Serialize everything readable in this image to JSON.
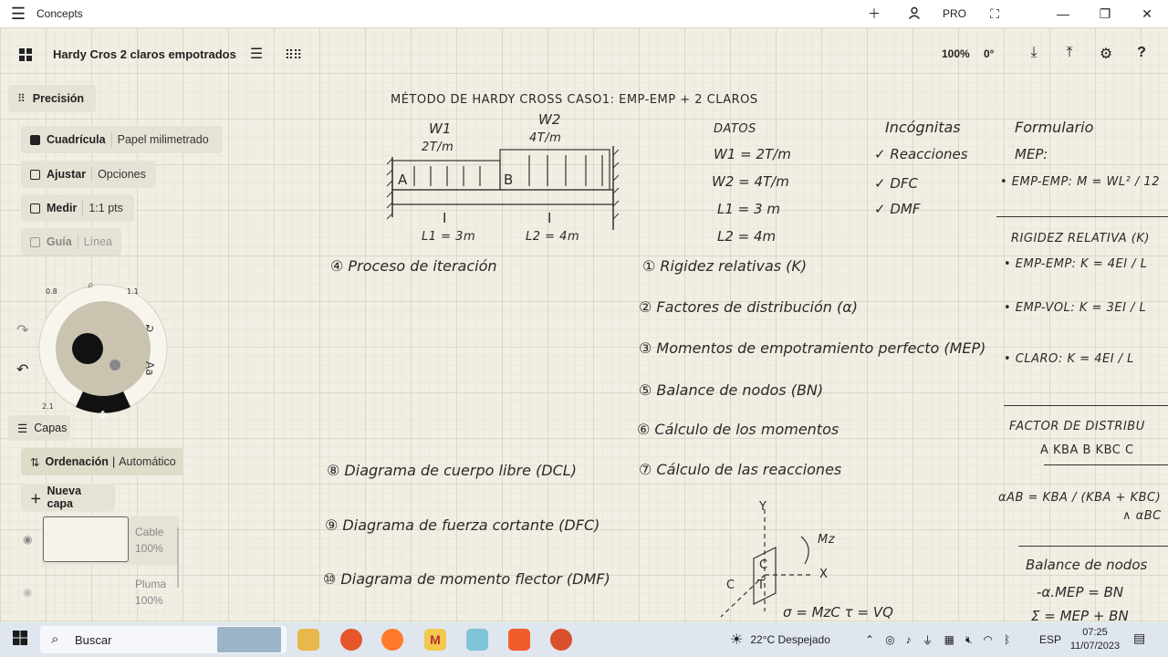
{
  "window": {
    "app_name": "Concepts",
    "pro_label": "PRO"
  },
  "toolbar": {
    "doc_title": "Hardy Cros 2 claros empotrados",
    "zoom": "100%",
    "angle": "0°"
  },
  "left_panel": {
    "precision_label": "Precisión",
    "grid_label": "Cuadrícula",
    "grid_value": "Papel milimetrado",
    "snap_label": "Ajustar",
    "snap_value": "Opciones",
    "measure_label": "Medir",
    "measure_value": "1:1 pts",
    "guide_label": "Guía",
    "guide_value": "Línea",
    "layers_label": "Capas",
    "sort_label": "Ordenación",
    "sort_value": "Automático",
    "new_layer_label": "Nueva capa",
    "layers": [
      {
        "name": "Cable",
        "opacity": "100%"
      },
      {
        "name": "Pluma",
        "opacity": "100%"
      }
    ]
  },
  "wheel": {
    "size_left": "0.8",
    "size_right": "1.1",
    "size_bottom": "2.1",
    "font_tool": "Aa"
  },
  "drawing": {
    "header": "MÉTODO DE HARDY CROSS   CASO1: EMP-EMP + 2 CLAROS",
    "beam": {
      "w1": "W1",
      "w1_val": "2T/m",
      "w2": "W2",
      "w2_val": "4T/m",
      "node_a": "A",
      "node_b": "B",
      "inertia_1": "I",
      "inertia_2": "I",
      "l1": "L1 = 3m",
      "l2": "L2 = 4m"
    },
    "datos": {
      "title": "DATOS",
      "lines": [
        "W1 = 2T/m",
        "W2 = 4T/m",
        "L1 = 3 m",
        "L2 = 4m"
      ]
    },
    "incognitas": {
      "title": "Incógnitas",
      "lines": [
        "✓ Reacciones",
        "✓ DFC",
        "✓ DMF"
      ]
    },
    "formulario": {
      "title": "Formulario",
      "mep": "MEP:",
      "mep_formula": "• EMP-EMP: M = WL² / 12",
      "rigidez_title": "RIGIDEZ RELATIVA (K)",
      "rig_1": "• EMP-EMP: K = 4EI / L",
      "rig_2": "• EMP-VOL: K = 3EI / L",
      "rig_3": "• CLARO: K = 4EI / L",
      "fd_title": "FACTOR DE DISTRIBU",
      "fd_nodes": "A  KBA  B  KBC  C",
      "alpha_ab": "αAB = KBA / (KBA + KBC)",
      "alpha_bc": "∧ αBC",
      "balance_title": "Balance de nodos",
      "balance_1": "-α.MEP = BN",
      "balance_2": "Σ = MEP + BN"
    },
    "steps": [
      "④ Proceso de iteración",
      "① Rigidez relativas (K)",
      "② Factores de distribución (α)",
      "③ Momentos de empotramiento perfecto (MEP)",
      "⑤ Balance de nodos (BN)",
      "⑥ Cálculo de los momentos",
      "⑦ Cálculo de las reacciones",
      "⑧ Diagrama de cuerpo libre (DCL)",
      "⑨ Diagrama de fuerza cortante (DFC)",
      "⑩ Diagrama de momento flector (DMF)"
    ],
    "axes": {
      "y": "Y",
      "x": "X",
      "mz": "Mz",
      "c": "C",
      "t": "T",
      "c2": "C",
      "formula": "σ = MzC   τ = VQ"
    }
  },
  "taskbar": {
    "search_label": "Buscar",
    "weather": "22°C  Despejado",
    "lang": "ESP",
    "time": "07:25",
    "date": "11/07/2023"
  }
}
